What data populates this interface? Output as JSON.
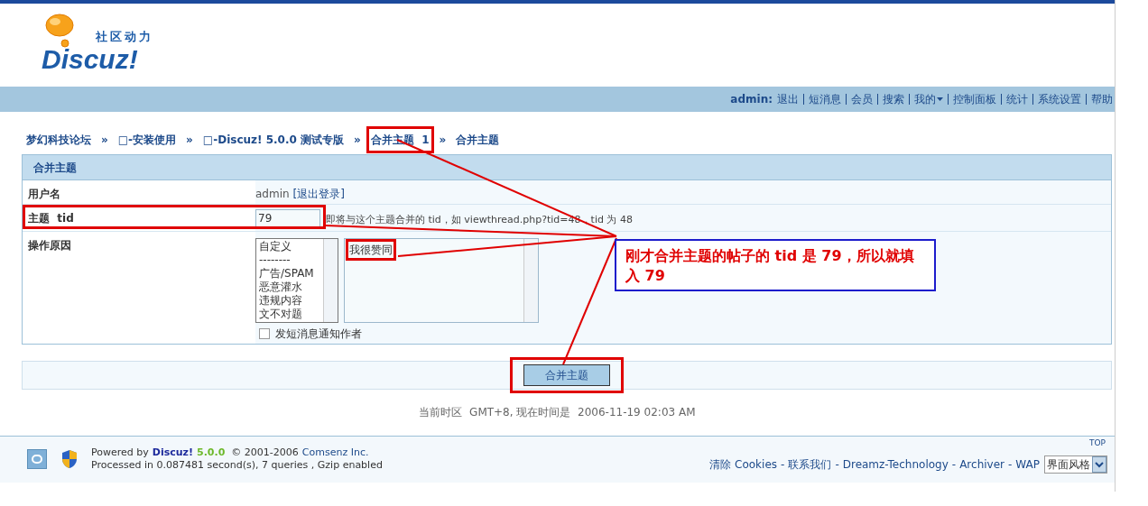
{
  "logo": {
    "tagline": "社区动力",
    "wordmark": "Discuz!"
  },
  "nav": {
    "user": "admin:",
    "links": [
      {
        "label": "退出",
        "kind": "link"
      },
      {
        "label": "短消息",
        "kind": "link"
      },
      {
        "label": "会员",
        "kind": "link"
      },
      {
        "label": "搜索",
        "kind": "link"
      },
      {
        "label": "我的",
        "kind": "menu"
      },
      {
        "label": "控制面板",
        "kind": "link"
      },
      {
        "label": "统计",
        "kind": "link"
      },
      {
        "label": "系统设置",
        "kind": "link"
      },
      {
        "label": "帮助",
        "kind": "link"
      }
    ]
  },
  "breadcrumb": [
    {
      "label": "梦幻科技论坛",
      "highlighted": false
    },
    {
      "sep": "»",
      "label": "□-安装使用",
      "highlighted": false
    },
    {
      "sep": "»",
      "label": "□-Discuz! 5.0.0 测试专版",
      "highlighted": false
    },
    {
      "sep": "»",
      "label": "合并主题  1",
      "highlighted": true
    },
    {
      "sep": "»",
      "label": "合并主题",
      "highlighted": false
    }
  ],
  "form": {
    "title": "合并主题",
    "rows": [
      {
        "kind": "text",
        "label": "用户名",
        "value": "admin",
        "link": "[退出登录]",
        "highlighted": false
      },
      {
        "kind": "input",
        "label": "主题  tid",
        "value": "79",
        "hint": "即将与这个主题合并的 tid，如 viewthread.php?tid=48，tid 为 48",
        "highlighted": true
      },
      {
        "kind": "reason",
        "label": "操作原因",
        "options": [
          "自定义",
          "--------",
          "广告/SPAM",
          "恶意灌水",
          "违规内容",
          "文不对题"
        ],
        "reason": "我很赞同",
        "reason_highlighted": true,
        "notify": {
          "label": "发短消息通知作者",
          "checked": false
        },
        "highlighted": false
      }
    ]
  },
  "submit": {
    "label": "合并主题",
    "highlighted": true
  },
  "callout": "刚才合并主题的帖子的 tid 是 79，所以就填入 79",
  "time": "当前时区  GMT+8, 现在时间是  2006-11-19 02:03 AM",
  "footer": {
    "powered": "Powered by",
    "brand": "Discuz!",
    "version": "5.0.0",
    "copyright": "© 2001-2006",
    "company": "Comsenz Inc.",
    "processed": "Processed in 0.087481 second(s), 7 queries , Gzip enabled",
    "top": "TOP",
    "links": [
      {
        "label": "清除 Cookies"
      },
      {
        "sep": "-",
        "label": "联系我们"
      },
      {
        "sep": "-",
        "label": "Dreamz-Technology"
      },
      {
        "sep": "-",
        "label": "Archiver"
      },
      {
        "sep": "-",
        "label": "WAP"
      }
    ],
    "style_select": "界面风格"
  }
}
